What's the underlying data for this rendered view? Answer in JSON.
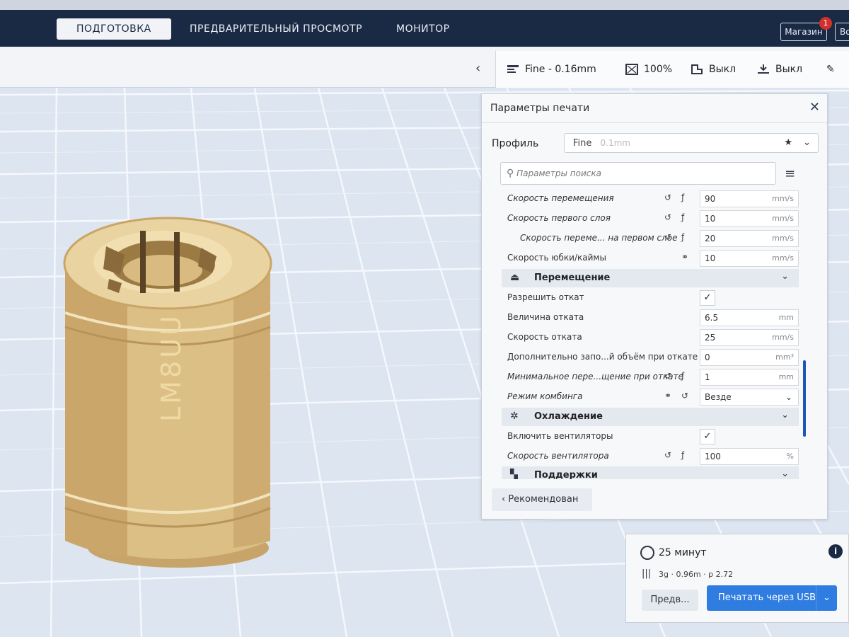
{
  "tabs": [
    {
      "label": "ПОДГОТОВКА",
      "active": true
    },
    {
      "label": "ПРЕДВАРИТЕЛЬНЫЙ ПРОСМОТР",
      "active": false
    },
    {
      "label": "МОНИТОР",
      "active": false
    }
  ],
  "header": {
    "store_label": "Магазин",
    "store_badge": "1",
    "more_label": "Во"
  },
  "settings_bar": {
    "profile": "Fine - 0.16mm",
    "infill": "100%",
    "support": "Выкл",
    "adhesion": "Выкл"
  },
  "panel": {
    "title": "Параметры печати",
    "profile_label": "Профиль",
    "profile_value": "Fine",
    "profile_sub": "0.1mm",
    "search_placeholder": "Параметры поиска",
    "recommended_label": "Рекомендован",
    "rows": [
      {
        "label": "Скорость перемещения",
        "value": "90",
        "unit": "mm/s"
      },
      {
        "label": "Скорость первого слоя",
        "value": "10",
        "unit": "mm/s"
      },
      {
        "label": "Скорость переме... на первом слое",
        "value": "20",
        "unit": "mm/s"
      },
      {
        "label": "Скорость юбки/каймы",
        "value": "10",
        "unit": "mm/s"
      },
      {
        "category": "Перемещение"
      },
      {
        "label": "Разрешить откат",
        "checked": true
      },
      {
        "label": "Величина отката",
        "value": "6.5",
        "unit": "mm"
      },
      {
        "label": "Скорость отката",
        "value": "25",
        "unit": "mm/s"
      },
      {
        "label": "Дополнительно запо...й объём при откате",
        "value": "0",
        "unit": "mm³"
      },
      {
        "label": "Минимальное пере...щение при откате",
        "value": "1",
        "unit": "mm"
      },
      {
        "label": "Режим комбинга",
        "select": "Везде"
      },
      {
        "category": "Охлаждение"
      },
      {
        "label": "Включить вентиляторы",
        "checked": true
      },
      {
        "label": "Скорость вентилятора",
        "value": "100",
        "unit": "%"
      },
      {
        "category": "Поддержки"
      }
    ]
  },
  "estimate": {
    "time": "25 минут",
    "material": "3g · 0.96m · р 2.72",
    "preview_label": "Предв...",
    "print_label": "Печатать через USB"
  },
  "model": {
    "engraving": "LM8UU"
  }
}
